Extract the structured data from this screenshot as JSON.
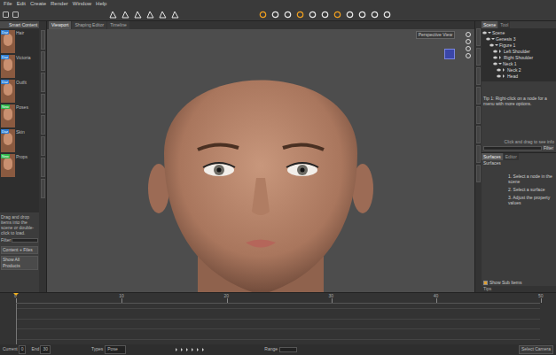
{
  "menu": [
    "File",
    "Edit",
    "Create",
    "Render",
    "Window",
    "Help"
  ],
  "left_panel": {
    "tabs": [
      {
        "label": "Smart Content",
        "selected": true
      }
    ],
    "items": [
      {
        "label": "Hair",
        "badge": "Daz",
        "color": "#2f7fd6"
      },
      {
        "label": "Victoria",
        "badge": "Daz",
        "color": "#2f7fd6"
      },
      {
        "label": "Outfit",
        "badge": "Daz",
        "color": "#2f7fd6"
      },
      {
        "label": "Poses",
        "badge": "New",
        "color": "#2fb84a"
      },
      {
        "label": "Skin",
        "badge": "Daz",
        "color": "#2f7fd6"
      },
      {
        "label": "Props",
        "badge": "New",
        "color": "#2fb84a"
      }
    ],
    "info": "Drag and drop items into the scene or double-click to load.",
    "field_label": "Filter",
    "buttons": [
      "Content + Files",
      "Show All Products"
    ]
  },
  "viewport": {
    "tabs": [
      {
        "label": "Viewport",
        "selected": true
      },
      {
        "label": "Shaping Editor",
        "selected": false
      },
      {
        "label": "Timeline",
        "selected": false
      }
    ],
    "view": "Perspective View"
  },
  "scene": {
    "tabs": [
      {
        "label": "Scene",
        "selected": true
      },
      {
        "label": "Tool",
        "selected": false
      }
    ],
    "tree": [
      {
        "label": "Scene",
        "expanded": true,
        "children": [
          {
            "label": "Genesis 3",
            "expanded": true,
            "children": [
              {
                "label": "Figure 1",
                "expanded": true,
                "children": [
                  {
                    "label": "Left Shoulder",
                    "expanded": false,
                    "children": []
                  },
                  {
                    "label": "Right Shoulder",
                    "expanded": false,
                    "children": []
                  },
                  {
                    "label": "Neck 1",
                    "expanded": true,
                    "children": [
                      {
                        "label": "Neck 2",
                        "expanded": false,
                        "children": []
                      },
                      {
                        "label": "Head",
                        "expanded": false,
                        "children": []
                      }
                    ]
                  }
                ]
              }
            ]
          }
        ]
      }
    ],
    "tip": "Tip 1: Right-click on a node for a menu with more options.",
    "hint": "Click and drag to see info",
    "filter_button": "Filter"
  },
  "surfaces": {
    "tabs": [
      {
        "label": "Surfaces",
        "selected": true
      },
      {
        "label": "Editor",
        "selected": false
      }
    ],
    "title": "Surfaces",
    "steps": [
      "1. Select a node in the scene",
      "2. Select a surface",
      "3. Adjust the property values"
    ],
    "show_sub": {
      "label": "Show Sub Items",
      "checked": true
    },
    "footer": "Tips"
  },
  "timeline": {
    "ticks": [
      "0",
      "10",
      "20",
      "30",
      "40",
      "50"
    ],
    "playhead": 0,
    "controls": [
      {
        "label": "Current",
        "value": "0"
      },
      {
        "label": "End",
        "value": "30"
      }
    ],
    "types_label": "Types",
    "types_value": "Pose",
    "range_label": "Range",
    "status": "Select Camera"
  }
}
